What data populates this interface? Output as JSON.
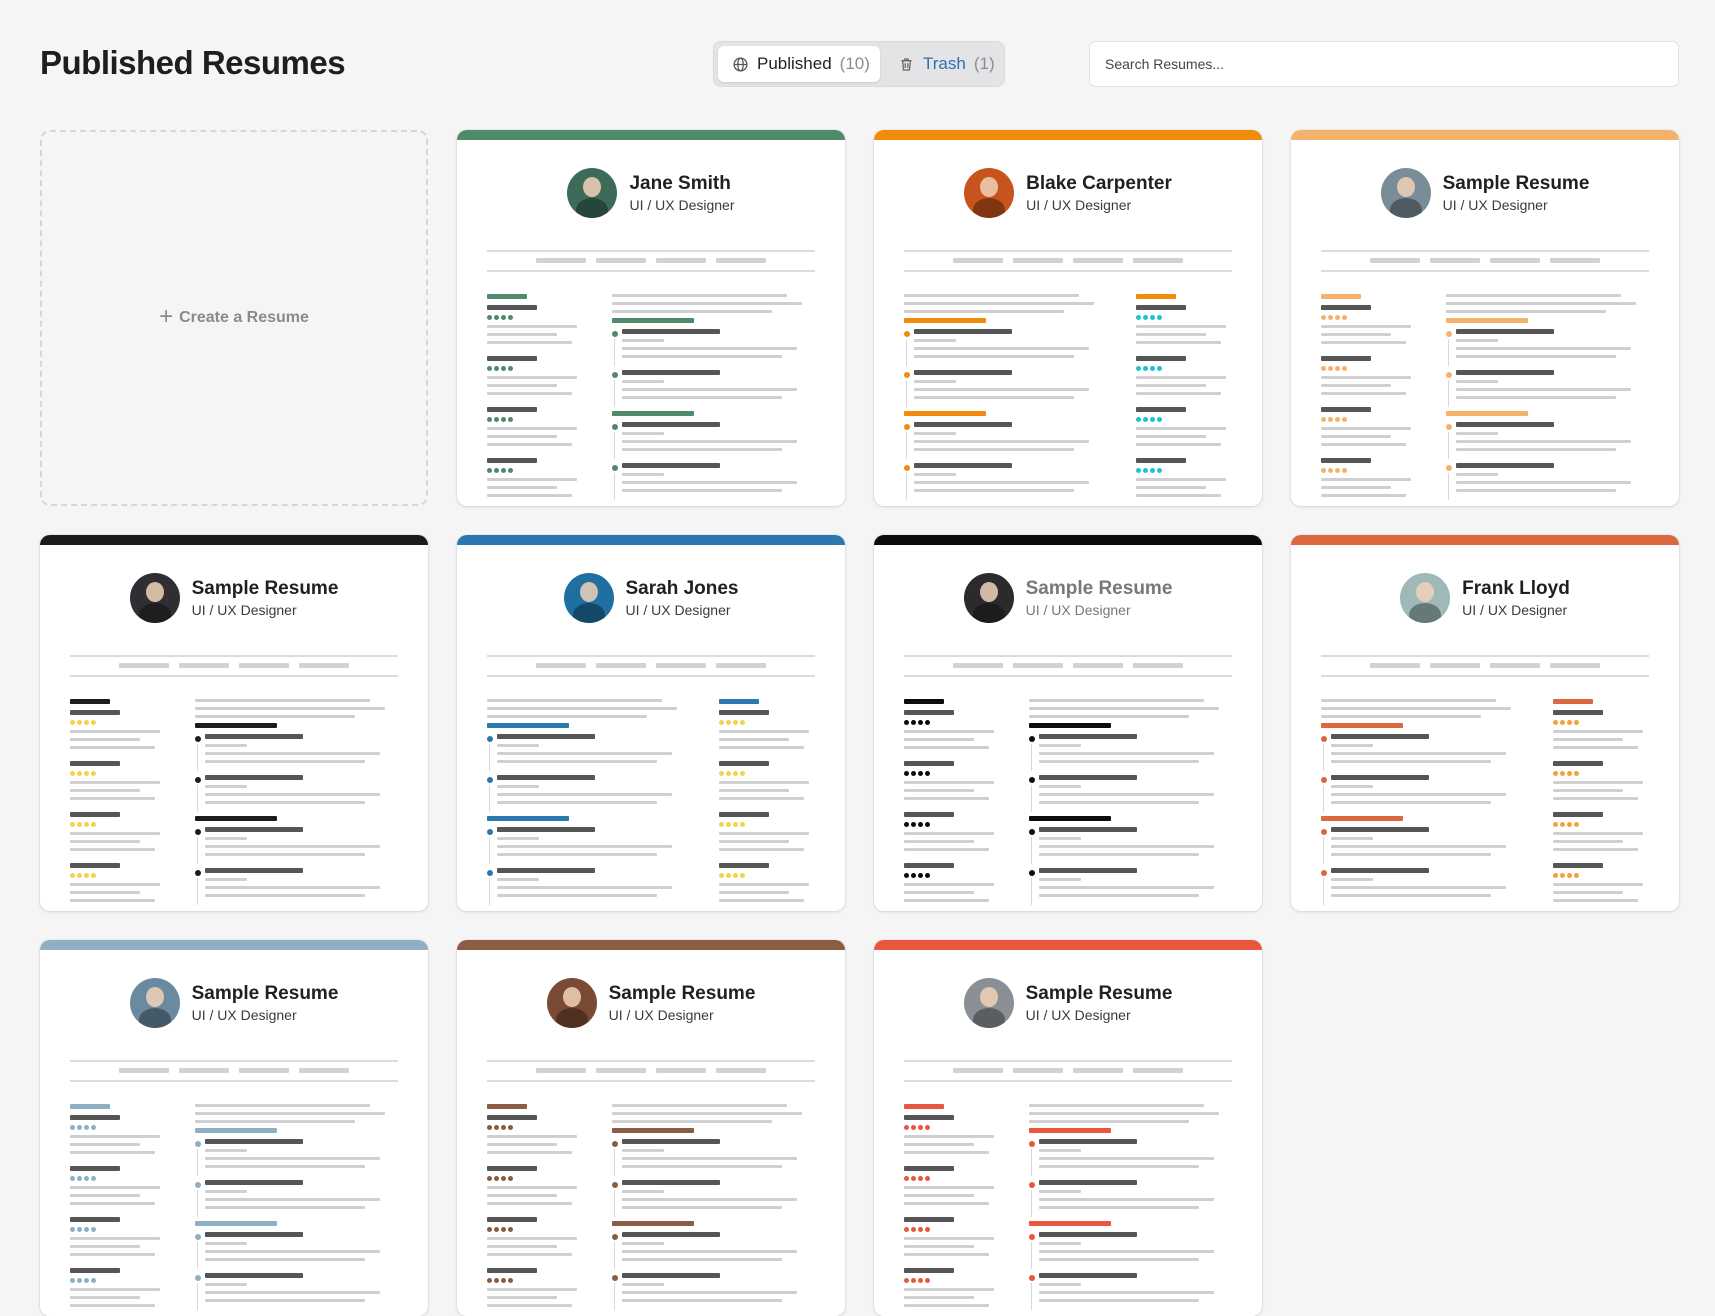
{
  "header": {
    "title": "Published Resumes",
    "tabs": [
      {
        "label": "Published",
        "count": "(10)",
        "icon": "globe-icon"
      },
      {
        "label": "Trash",
        "count": "(1)",
        "icon": "trash-icon"
      }
    ],
    "search": {
      "placeholder": "Search Resumes..."
    }
  },
  "create_card": {
    "label": "Create a Resume",
    "icon": "plus-icon"
  },
  "resumes": [
    {
      "name": "Jane Smith",
      "role": "UI / UX Designer",
      "accent": "#4f8a6b",
      "layout": "left"
    },
    {
      "name": "Blake Carpenter",
      "role": "UI / UX Designer",
      "accent": "#f28b0c",
      "layout": "right",
      "dots": "#1ec3d0"
    },
    {
      "name": "Sample Resume",
      "role": "UI / UX Designer",
      "accent": "#f4b26c",
      "layout": "left"
    },
    {
      "name": "Sample Resume",
      "role": "UI / UX Designer",
      "accent": "#1c1c1f",
      "layout": "left",
      "dots": "#f2d34a"
    },
    {
      "name": "Sarah Jones",
      "role": "UI / UX Designer",
      "accent": "#2a78ad",
      "layout": "right",
      "dots": "#f2d34a"
    },
    {
      "name": "Sample Resume",
      "role": "UI / UX Designer",
      "accent": "#0c0c0e",
      "layout": "left",
      "faded": true
    },
    {
      "name": "Frank Lloyd",
      "role": "UI / UX Designer",
      "accent": "#d9683f",
      "layout": "right",
      "dots": "#f2a23a"
    },
    {
      "name": "Sample Resume",
      "role": "UI / UX Designer",
      "accent": "#8fb0c4",
      "layout": "left"
    },
    {
      "name": "Sample Resume",
      "role": "UI / UX Designer",
      "accent": "#8a5c44",
      "layout": "left"
    },
    {
      "name": "Sample Resume",
      "role": "UI / UX Designer",
      "accent": "#e8573d",
      "layout": "left"
    }
  ]
}
